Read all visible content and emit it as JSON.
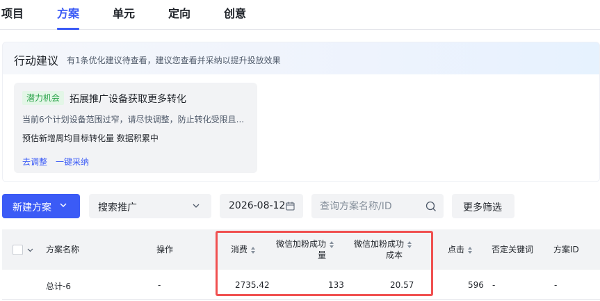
{
  "tabs": [
    {
      "label": "项目",
      "active": false
    },
    {
      "label": "方案",
      "active": true
    },
    {
      "label": "单元",
      "active": false
    },
    {
      "label": "定向",
      "active": false
    },
    {
      "label": "创意",
      "active": false
    }
  ],
  "advice": {
    "title": "行动建议",
    "subtitle": "有1条优化建议待查看，建议您查看并采纳以提升投放效果",
    "card": {
      "tag": "潜力机会",
      "title": "拓展推广设备获取更多转化",
      "desc": "当前6个计划设备范围过窄，请尽快调整，防止转化受限且...",
      "estimate": "预估新增周均目标转化量 数据积累中",
      "link_adjust": "去调整",
      "link_adopt": "一键采纳"
    }
  },
  "toolbar": {
    "new_plan": "新建方案",
    "select_value": "搜索推广",
    "date": "2026-08-12",
    "search_placeholder": "查询方案名称/ID",
    "more_filters": "更多筛选"
  },
  "table": {
    "headers": {
      "name": "方案名称",
      "action": "操作",
      "spend": "消费",
      "wx_fans_1": "微信加粉成功",
      "wx_fans_2": "量",
      "wx_cost_1": "微信加粉成功",
      "wx_cost_2": "成本",
      "clicks": "点击",
      "neg_kw": "否定关键词",
      "plan_id": "方案ID"
    },
    "total_row": {
      "name": "总计-6",
      "action": "-",
      "spend": "2735.42",
      "wx_fans": "133",
      "wx_cost": "20.57",
      "clicks": "596",
      "neg_kw": "-",
      "plan_id": "-"
    }
  },
  "colors": {
    "accent": "#3b5bf6",
    "highlight": "#f05050",
    "tag_green": "#2ba34a"
  },
  "icons": [
    "chevron-down-icon",
    "calendar-icon",
    "search-icon",
    "sort-icon",
    "checkbox-icon"
  ]
}
